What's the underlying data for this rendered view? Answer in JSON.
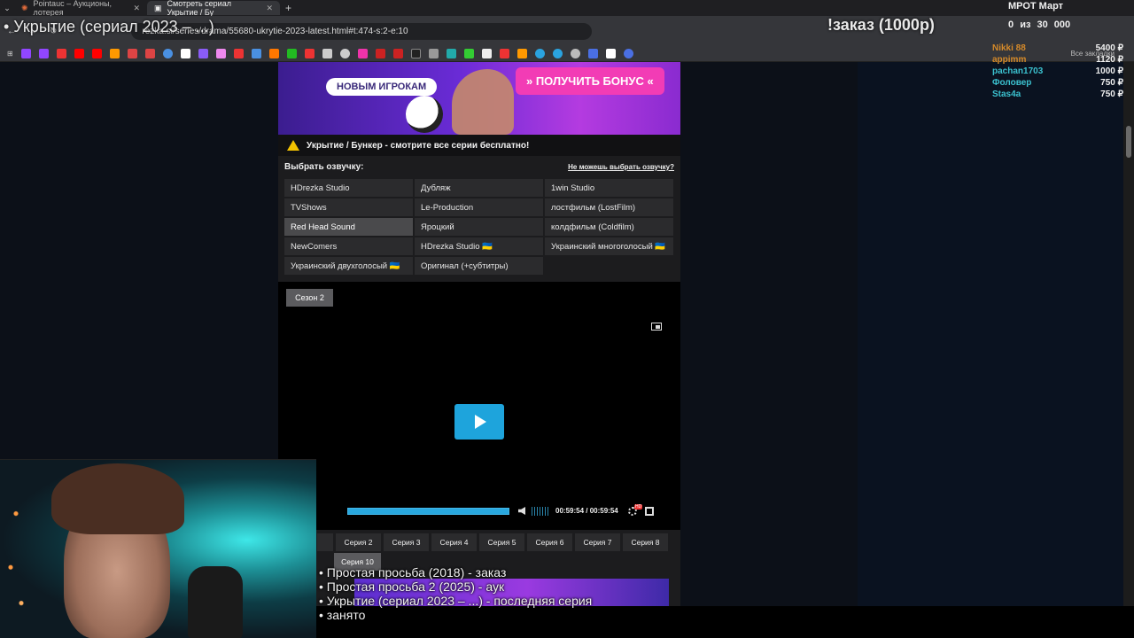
{
  "browser": {
    "tabs": [
      {
        "label": "Pointauc – Аукционы, лотерея"
      },
      {
        "label": "Смотреть сериал Укрытие / Бу"
      }
    ],
    "url": "rezka.si/series/drama/55680-ukrytie-2023-latest.html#t:474-s:2-e:10",
    "bookmarks_all": "Все закладки"
  },
  "overlay": {
    "title": "• Укрытие (сериал 2023 – ...)",
    "order_text": "!заказ (1000р)",
    "mrot_label": "МРОТ Март",
    "goal_current": "0",
    "goal_of": "из",
    "goal_target": "30 000",
    "donors": [
      {
        "name": "Nikki 88",
        "amount": "5400 ₽"
      },
      {
        "name": "appimm",
        "amount": "1120 ₽"
      },
      {
        "name": "pachan1703",
        "amount": "1000 ₽"
      },
      {
        "name": "Фоловер",
        "amount": "750 ₽"
      },
      {
        "name": "Stas4a",
        "amount": "750 ₽"
      }
    ],
    "queue": [
      "Простая просьба (2018) - заказ",
      "Простая просьба 2 (2025) - аук",
      "Укрытие (сериал 2023 – ...) - последняя серия",
      "занято"
    ]
  },
  "banner": {
    "pill": "НОВЫМ ИГРОКАМ",
    "button": "» ПОЛУЧИТЬ БОНУС «"
  },
  "notice": "Укрытие / Бункер - смотрите все серии бесплатно!",
  "dub": {
    "label": "Выбрать озвучку:",
    "help_link": "Не можешь выбрать озвучку?",
    "options": [
      "HDrezka Studio",
      "Дубляж",
      "1win Studio",
      "TVShows",
      "Le-Production",
      "лостфильм (LostFilm)",
      "Red Head Sound",
      "Яроцкий",
      "колдфильм (Coldfilm)",
      "NewComers",
      "HDrezka Studio 🇺🇦",
      "Украинский многоголосый 🇺🇦",
      "Украинский двухголосый 🇺🇦",
      "Оригинал (+субтитры)"
    ],
    "selected": "Red Head Sound"
  },
  "player": {
    "season": "Сезон 2",
    "time": "00:59:54 / 00:59:54",
    "progress": 1.0
  },
  "episodes": [
    "Серия 2",
    "Серия 3",
    "Серия 4",
    "Серия 5",
    "Серия 6",
    "Серия 7",
    "Серия 8"
  ],
  "current_episode": "Серия 10",
  "colors": {
    "accent": "#1ea4dc",
    "bonus": "#f23cb5",
    "donor_name": "#d58a2a"
  }
}
